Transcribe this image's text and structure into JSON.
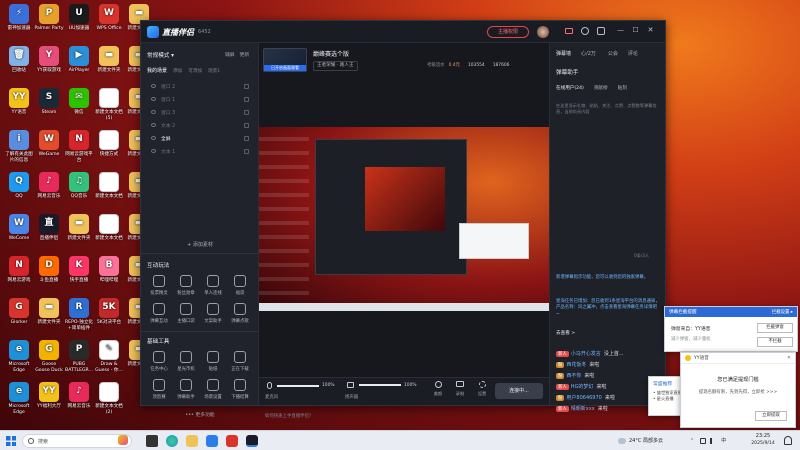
{
  "desktop_icons": [
    {
      "label": "雷神加速器",
      "color": "#3b6fd9",
      "glyph": "⚡"
    },
    {
      "label": "Palmer Party",
      "color": "#e6a12a",
      "glyph": "P"
    },
    {
      "label": "UU加速器",
      "color": "#1a1a1a",
      "glyph": "U"
    },
    {
      "label": "WPS Office",
      "color": "#d9342b",
      "glyph": "W"
    },
    {
      "label": "新建文件夹",
      "color": "#f0c25a",
      "glyph": "▬"
    },
    {
      "label": "回收站",
      "color": "#7fb2e6",
      "glyph": "🗑"
    },
    {
      "label": "YY获取游戏",
      "color": "#e74d7a",
      "glyph": "Y"
    },
    {
      "label": "AirPlayer",
      "color": "#2b8fd6",
      "glyph": "▶"
    },
    {
      "label": "新建文件夹",
      "color": "#f0c25a",
      "glyph": "▬"
    },
    {
      "label": "新建文件夹",
      "color": "#f0c25a",
      "glyph": "▬"
    },
    {
      "label": "YY语音",
      "color": "#f2c21b",
      "glyph": "YY"
    },
    {
      "label": "Steam",
      "color": "#1b2838",
      "glyph": "S"
    },
    {
      "label": "微信",
      "color": "#2dc100",
      "glyph": "✉"
    },
    {
      "label": "新建文本文档 (5)",
      "color": "#ffffff",
      "glyph": ""
    },
    {
      "label": "新建文件夹",
      "color": "#f0c25a",
      "glyph": "▬"
    },
    {
      "label": "了解有关此图片的信息",
      "color": "#5a8de0",
      "glyph": "i"
    },
    {
      "label": "WeGame",
      "color": "#e24b2c",
      "glyph": "W"
    },
    {
      "label": "网易云游戏平台",
      "color": "#d6252b",
      "glyph": "N"
    },
    {
      "label": "快捷方式",
      "color": "#ffffff",
      "glyph": ""
    },
    {
      "label": "新建文件夹",
      "color": "#f0c25a",
      "glyph": "▬"
    },
    {
      "label": "QQ",
      "color": "#1d9bf0",
      "glyph": "Q"
    },
    {
      "label": "网易云音乐",
      "color": "#e82a5b",
      "glyph": "♪"
    },
    {
      "label": "QQ音乐",
      "color": "#31c27c",
      "glyph": "♫"
    },
    {
      "label": "新建文本文档",
      "color": "#ffffff",
      "glyph": ""
    },
    {
      "label": "新建文件夹",
      "color": "#f0c25a",
      "glyph": "▬"
    },
    {
      "label": "WeCome",
      "color": "#4a86e8",
      "glyph": "W"
    },
    {
      "label": "直播伴侣",
      "color": "#1a1a2a",
      "glyph": "直"
    },
    {
      "label": "新建文件夹",
      "color": "#f0c25a",
      "glyph": "▬"
    },
    {
      "label": "新建文本文档",
      "color": "#ffffff",
      "glyph": ""
    },
    {
      "label": "新建文件夹",
      "color": "#f0c25a",
      "glyph": "▬"
    },
    {
      "label": "网易云游戏",
      "color": "#d6252b",
      "glyph": "N"
    },
    {
      "label": "斗鱼直播",
      "color": "#ff6a00",
      "glyph": "D"
    },
    {
      "label": "快手直播",
      "color": "#fe3666",
      "glyph": "K"
    },
    {
      "label": "哔哩哔哩",
      "color": "#fb7299",
      "glyph": "B"
    },
    {
      "label": "新建文件夹",
      "color": "#f0c25a",
      "glyph": "▬"
    },
    {
      "label": "Glorker",
      "color": "#d9342b",
      "glyph": "G"
    },
    {
      "label": "新建文件夹",
      "color": "#f0c25a",
      "glyph": "▬"
    },
    {
      "label": "REPO-独立化+简单插件",
      "color": "#2d6fd2",
      "glyph": "R"
    },
    {
      "label": "5K对决平台",
      "color": "#c12a2a",
      "glyph": "5K"
    },
    {
      "label": "新建文件夹",
      "color": "#f0c25a",
      "glyph": "▬"
    },
    {
      "label": "Microsoft Edge",
      "color": "#1f8fd6",
      "glyph": "e"
    },
    {
      "label": "Goose Goose Duck",
      "color": "#f0b400",
      "glyph": "G"
    },
    {
      "label": "PUBG BATTLEGR...",
      "color": "#2a2a2a",
      "glyph": "P"
    },
    {
      "label": "Draw & Guess - 你...",
      "color": "#ffffff",
      "glyph": "✎"
    },
    {
      "label": "新建文件夹",
      "color": "#f0c25a",
      "glyph": "▬"
    },
    {
      "label": "Microsoft Edge",
      "color": "#1f8fd6",
      "glyph": "e"
    },
    {
      "label": "YY福利大厅",
      "color": "#f2c21b",
      "glyph": "YY"
    },
    {
      "label": "网易云音乐",
      "color": "#e82a5b",
      "glyph": "♪"
    },
    {
      "label": "新建文本文档 (2)",
      "color": "#ffffff",
      "glyph": ""
    }
  ],
  "app": {
    "logo_text": "直播伴侣",
    "version": "6452",
    "start_live": "主播权限",
    "window_controls": [
      "—",
      "☐",
      "✕"
    ],
    "left": {
      "mode_label": "常规模式 ▾",
      "mode_actions": [
        "辅屏",
        "更新"
      ],
      "tabs": [
        "我的场景",
        "添加",
        "可添加",
        "场景1"
      ],
      "sources": [
        "窗口 2",
        "窗口 1",
        "窗口 3",
        "文本 2",
        "全屏",
        "文本 1"
      ],
      "add_source": "+ 添加素材",
      "interact_title": "互动玩法",
      "interact_tools": [
        "投票精灵",
        "粉丝勋章",
        "单人连线",
        "福袋",
        "弹幕互动",
        "主播口袋",
        "文案助手",
        "弹幕点歌"
      ],
      "basic_title": "基础工具",
      "basic_tools": [
        "任务中心",
        "星光币机",
        "贴纸",
        "正在下载",
        "顶直赛",
        "弹幕助手",
        "场景设置",
        "下播结算"
      ],
      "more_tools": "••• 更多功能"
    },
    "center": {
      "preview_tag": "已开启画面观看",
      "stream_title": "巅峰赛选个版",
      "category": "王者荣耀 · 路人王",
      "stats": [
        "考级流水",
        "0.4元",
        "103554",
        "187606"
      ],
      "mic_label": "麦克风",
      "mic_vol": "100%",
      "speaker_label": "扬声器",
      "speaker_vol": "100%",
      "bottom_btns": [
        "美颜",
        "录制",
        "设置"
      ],
      "connect_btn": "连接中...",
      "status_line": "如何快速上手直播伴侣?",
      "status_stats": [
        "码率(0kb/s)",
        "FPS:60",
        "丢帧:0(0.00%)",
        "CPU:10%",
        "内存:43%",
        "1分钟"
      ]
    },
    "right": {
      "top_tabs": [
        "弹幕墙",
        "心/2万",
        "公会",
        "评论"
      ],
      "assistant_title": "弹幕助手",
      "sub_tabs": [
        "在线用户(24)",
        "贡献榜",
        "贴刻"
      ],
      "hint": "在这里显示礼物、贴贴、关注、点赞、点赞数等弹幕信息，当前尚无内容",
      "notice1": "新增弹幕指示功能，您可以收到您的独家弹幕。",
      "notice2": "星海任务已增加：您已收到1条星海平台的消息通知，产品名称：风之翼冲，点击查看星海弹幕任务详情吧~",
      "notice_more": "去查看 >",
      "chat": [
        {
          "badge": "新人",
          "name": "小马开心发言",
          "text": "没上首...",
          "color": "#e34b4b"
        },
        {
          "badge": "粉",
          "name": "西花饭冬",
          "text": "来啦",
          "color": "#c98b2f"
        },
        {
          "badge": "粉",
          "name": "西不你",
          "text": "来啦",
          "color": "#c98b2f"
        },
        {
          "badge": "新人",
          "name": "HG的梦幻",
          "text": "来啦",
          "color": "#e34b4b"
        },
        {
          "badge": "粉",
          "name": "用户80646970",
          "text": "来啦",
          "color": "#c98b2f"
        },
        {
          "badge": "新人",
          "name": "晴朝新xxx",
          "text": "来啦",
          "color": "#e34b4b"
        }
      ],
      "online_count": "0条/3人"
    }
  },
  "popup_notice": {
    "title": "弹幕拦截提醒",
    "settings": "拦截设置 ▸",
    "source": "弹窗来自：YY语音",
    "desc": "减少弹窗，减少骚扰",
    "btn1": "拦截弹窗",
    "btn2": "不拦截"
  },
  "popup_yy": {
    "title": "YY语音",
    "heading": "您已满足提现门槛",
    "body": "提现名额有限，先到先得，立即抢 >>>",
    "cta": "立即提取"
  },
  "popup_side": {
    "title": "常盛推荐",
    "lines": [
      "• 盛世独家直播",
      "• 星火直播"
    ]
  },
  "taskbar": {
    "search_placeholder": "搜索",
    "weather": "24°C 局部多云",
    "time": "23:25",
    "date": "2025/9/14",
    "ime": "中"
  }
}
